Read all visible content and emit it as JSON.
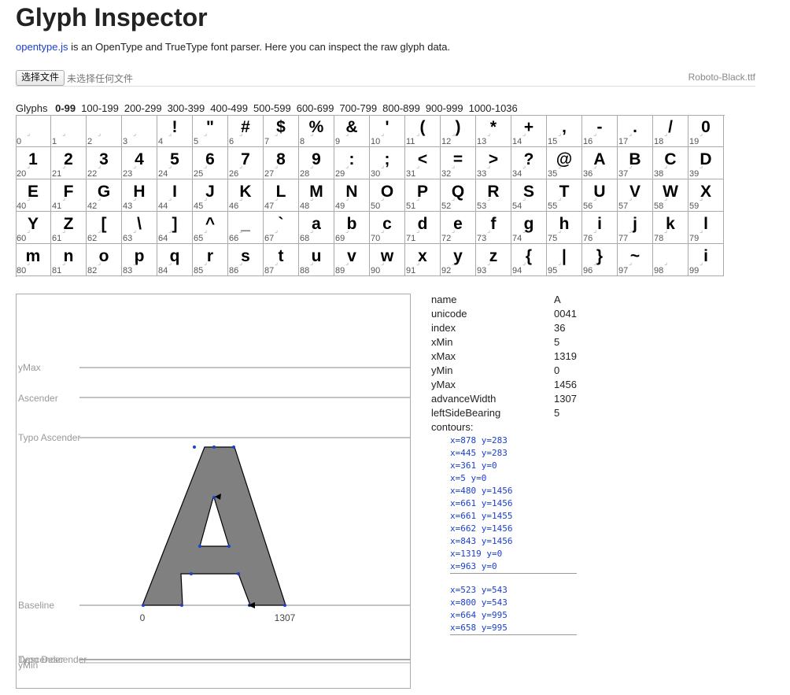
{
  "title": "Glyph Inspector",
  "intro": {
    "link": "opentype.js",
    "text": " is an OpenType and TrueType font parser. Here you can inspect the raw glyph data."
  },
  "file": {
    "button": "选择文件",
    "no_file": "未选择任何文件",
    "font_name": "Roboto-Black.ttf"
  },
  "pager": {
    "label": "Glyphs",
    "pages": [
      "0-99",
      "100-199",
      "200-299",
      "300-399",
      "400-499",
      "500-599",
      "600-699",
      "700-799",
      "800-899",
      "900-999",
      "1000-1036"
    ],
    "active": 0
  },
  "glyphs": [
    "",
    "",
    "",
    "",
    "!",
    "\"",
    "#",
    "$",
    "%",
    "&",
    "'",
    "(",
    ")",
    "*",
    "+",
    ",",
    "-",
    ".",
    "/",
    "0",
    "1",
    "2",
    "3",
    "4",
    "5",
    "6",
    "7",
    "8",
    "9",
    ":",
    ";",
    "<",
    "=",
    ">",
    "?",
    "@",
    "A",
    "B",
    "C",
    "D",
    "E",
    "F",
    "G",
    "H",
    "I",
    "J",
    "K",
    "L",
    "M",
    "N",
    "O",
    "P",
    "Q",
    "R",
    "S",
    "T",
    "U",
    "V",
    "W",
    "X",
    "Y",
    "Z",
    "[",
    "\\",
    "]",
    "^",
    "_",
    "`",
    "a",
    "b",
    "c",
    "d",
    "e",
    "f",
    "g",
    "h",
    "i",
    "j",
    "k",
    "l",
    "m",
    "n",
    "o",
    "p",
    "q",
    "r",
    "s",
    "t",
    "u",
    "v",
    "w",
    "x",
    "y",
    "z",
    "{",
    "|",
    "}",
    "~",
    "",
    "i"
  ],
  "viewer": {
    "labels": {
      "ymax": "yMax",
      "ascender": "Ascender",
      "typo_ascender": "Typo Ascender",
      "baseline": "Baseline",
      "descender": "Descender",
      "typo_descender": "Typo Descender",
      "ymin": "yMin"
    },
    "x_start": "0",
    "x_advance": "1307"
  },
  "properties": [
    {
      "key": "name",
      "value": "A"
    },
    {
      "key": "unicode",
      "value": "0041"
    },
    {
      "key": "index",
      "value": "36"
    },
    {
      "key": "xMin",
      "value": "5"
    },
    {
      "key": "xMax",
      "value": "1319"
    },
    {
      "key": "yMin",
      "value": "0"
    },
    {
      "key": "yMax",
      "value": "1456"
    },
    {
      "key": "advanceWidth",
      "value": "1307"
    },
    {
      "key": "leftSideBearing",
      "value": "5"
    }
  ],
  "contours_label": "contours:",
  "contours": [
    [
      "x=878 y=283",
      "x=445 y=283",
      "x=361 y=0",
      "x=5 y=0",
      "x=480 y=1456",
      "x=661 y=1456",
      "x=661 y=1455",
      "x=662 y=1456",
      "x=843 y=1456",
      "x=1319 y=0",
      "x=963 y=0"
    ],
    [
      "x=523 y=543",
      "x=800 y=543",
      "x=664 y=995",
      "x=658 y=995"
    ]
  ]
}
